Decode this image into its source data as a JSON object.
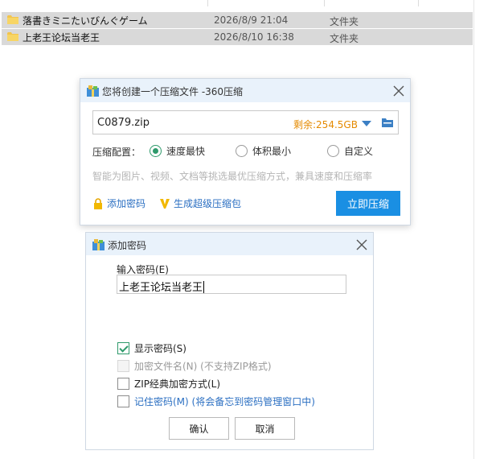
{
  "explorer": {
    "files": [
      {
        "name": "落書きミニたいびんぐゲーム",
        "date": "2026/8/9 21:04",
        "type": "文件夹"
      },
      {
        "name": "上老王论坛当老王",
        "date": "2026/8/10 16:38",
        "type": "文件夹"
      }
    ]
  },
  "compress_dialog": {
    "title": "您将创建一个压缩文件 -360压缩",
    "file_name": "C0879.zip",
    "free_space": "剩余:254.5GB",
    "config_label": "压缩配置：",
    "options": [
      {
        "label": "速度最快",
        "selected": true
      },
      {
        "label": "体积最小",
        "selected": false
      },
      {
        "label": "自定义",
        "selected": false
      }
    ],
    "hint": "智能为图片、视频、文档等挑选最优压缩方式，兼具速度和压缩率",
    "add_password_link": "添加密码",
    "super_compress_link": "生成超级压缩包",
    "compress_button": "立即压缩"
  },
  "password_dialog": {
    "title": "添加密码",
    "input_label": "输入密码(E)",
    "password_value": "上老王论坛当老王",
    "checkboxes": [
      {
        "label": "显示密码(S)",
        "checked": true,
        "enabled": true
      },
      {
        "label": "加密文件名(N) (不支持ZIP格式)",
        "checked": false,
        "enabled": false
      },
      {
        "label": "ZIP经典加密方式(L)",
        "checked": false,
        "enabled": true
      },
      {
        "label": "记住密码(M) (将会备忘到密码管理窗口中)",
        "checked": false,
        "enabled": true
      }
    ],
    "ok_button": "确认",
    "cancel_button": "取消"
  },
  "colors": {
    "accent_blue": "#1a8fe3",
    "link_blue": "#2b6fc2",
    "free_space_orange": "#e58a00",
    "radio_green": "#2e9a6b",
    "titlebar_bg": "#e9f2fb"
  },
  "icons": [
    "folder-icon",
    "archive-app-icon",
    "close-icon",
    "dropdown-arrow-icon",
    "browse-folder-icon",
    "lock-icon",
    "v-badge-icon"
  ]
}
